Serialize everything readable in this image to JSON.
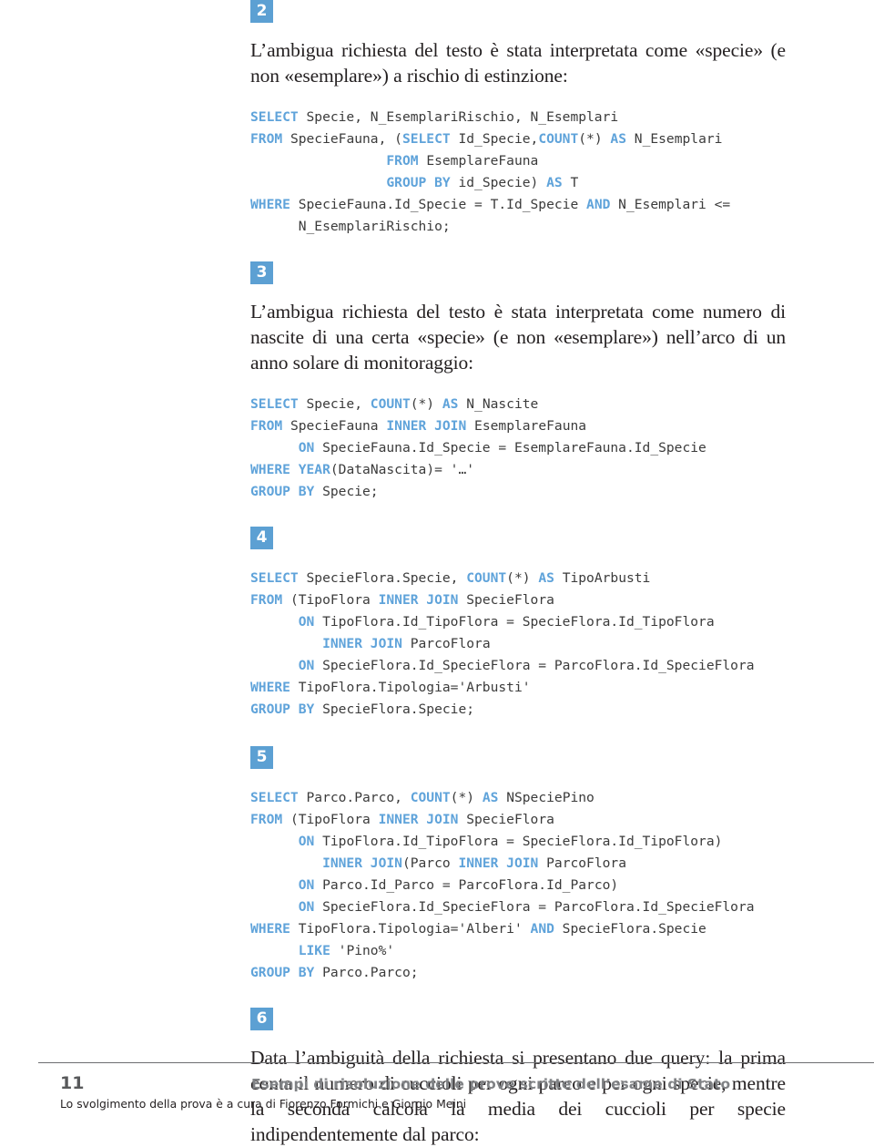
{
  "page": {
    "number": "11",
    "footer_title": "Esempi di risoluzione delle prove scritte dell’esame di Stato",
    "footer_note": "Lo svolgimento della prova è a cura di Fiorenzo Formichi e Giorgio Meini",
    "accent_color": "#5ca0d3",
    "keyword_color": "#5fa3da",
    "text_color": "#231f20",
    "footer_rule_color": "#6d6e71"
  },
  "sections": [
    {
      "badge": "2",
      "paragraph": "L’ambigua richiesta del testo è stata interpretata come «specie» (e non «esemplare») a rischio di estinzione:",
      "code_lines": [
        [
          {
            "t": "SELECT",
            "k": true
          },
          {
            "t": " Specie, N_EsemplariRischio, N_Esemplari",
            "k": false
          }
        ],
        [
          {
            "t": "FROM",
            "k": true
          },
          {
            "t": " SpecieFauna, (",
            "k": false
          },
          {
            "t": "SELECT",
            "k": true
          },
          {
            "t": " Id_Specie,",
            "k": false
          },
          {
            "t": "COUNT",
            "k": true
          },
          {
            "t": "(*) ",
            "k": false
          },
          {
            "t": "AS",
            "k": true
          },
          {
            "t": " N_Esemplari",
            "k": false
          }
        ],
        [
          {
            "t": "                 ",
            "k": false
          },
          {
            "t": "FROM",
            "k": true
          },
          {
            "t": " EsemplareFauna",
            "k": false
          }
        ],
        [
          {
            "t": "                 ",
            "k": false
          },
          {
            "t": "GROUP BY",
            "k": true
          },
          {
            "t": " id_Specie) ",
            "k": false
          },
          {
            "t": "AS",
            "k": true
          },
          {
            "t": " T",
            "k": false
          }
        ],
        [
          {
            "t": "WHERE",
            "k": true
          },
          {
            "t": " SpecieFauna.Id_Specie = T.Id_Specie ",
            "k": false
          },
          {
            "t": "AND",
            "k": true
          },
          {
            "t": " N_Esemplari <=",
            "k": false
          }
        ],
        [
          {
            "t": "      N_EsemplariRischio;",
            "k": false
          }
        ]
      ]
    },
    {
      "badge": "3",
      "paragraph": "L’ambigua richiesta del testo è stata interpretata come numero di nascite di una certa «specie» (e non «esemplare») nell’arco di un anno solare di monitoraggio:",
      "code_lines": [
        [
          {
            "t": "SELECT",
            "k": true
          },
          {
            "t": " Specie, ",
            "k": false
          },
          {
            "t": "COUNT",
            "k": true
          },
          {
            "t": "(*) ",
            "k": false
          },
          {
            "t": "AS",
            "k": true
          },
          {
            "t": " N_Nascite",
            "k": false
          }
        ],
        [
          {
            "t": "FROM",
            "k": true
          },
          {
            "t": " SpecieFauna ",
            "k": false
          },
          {
            "t": "INNER JOIN",
            "k": true
          },
          {
            "t": " EsemplareFauna",
            "k": false
          }
        ],
        [
          {
            "t": "      ",
            "k": false
          },
          {
            "t": "ON",
            "k": true
          },
          {
            "t": " SpecieFauna.Id_Specie = EsemplareFauna.Id_Specie",
            "k": false
          }
        ],
        [
          {
            "t": "WHERE",
            "k": true
          },
          {
            "t": " ",
            "k": false
          },
          {
            "t": "YEAR",
            "k": true
          },
          {
            "t": "(DataNascita)= '…'",
            "k": false
          }
        ],
        [
          {
            "t": "GROUP BY",
            "k": true
          },
          {
            "t": " Specie;",
            "k": false
          }
        ]
      ]
    },
    {
      "badge": "4",
      "paragraph": "",
      "code_lines": [
        [
          {
            "t": "SELECT",
            "k": true
          },
          {
            "t": " SpecieFlora.Specie, ",
            "k": false
          },
          {
            "t": "COUNT",
            "k": true
          },
          {
            "t": "(*) ",
            "k": false
          },
          {
            "t": "AS",
            "k": true
          },
          {
            "t": " TipoArbusti",
            "k": false
          }
        ],
        [
          {
            "t": "FROM",
            "k": true
          },
          {
            "t": " (TipoFlora ",
            "k": false
          },
          {
            "t": "INNER JOIN",
            "k": true
          },
          {
            "t": " SpecieFlora",
            "k": false
          }
        ],
        [
          {
            "t": "      ",
            "k": false
          },
          {
            "t": "ON",
            "k": true
          },
          {
            "t": " TipoFlora.Id_TipoFlora = SpecieFlora.Id_TipoFlora",
            "k": false
          }
        ],
        [
          {
            "t": "         ",
            "k": false
          },
          {
            "t": "INNER JOIN",
            "k": true
          },
          {
            "t": " ParcoFlora",
            "k": false
          }
        ],
        [
          {
            "t": "      ",
            "k": false
          },
          {
            "t": "ON",
            "k": true
          },
          {
            "t": " SpecieFlora.Id_SpecieFlora = ParcoFlora.Id_SpecieFlora",
            "k": false
          }
        ],
        [
          {
            "t": "WHERE",
            "k": true
          },
          {
            "t": " TipoFlora.Tipologia='Arbusti'",
            "k": false
          }
        ],
        [
          {
            "t": "GROUP BY",
            "k": true
          },
          {
            "t": " SpecieFlora.Specie;",
            "k": false
          }
        ]
      ]
    },
    {
      "badge": "5",
      "paragraph": "",
      "code_lines": [
        [
          {
            "t": "SELECT",
            "k": true
          },
          {
            "t": " Parco.Parco, ",
            "k": false
          },
          {
            "t": "COUNT",
            "k": true
          },
          {
            "t": "(*) ",
            "k": false
          },
          {
            "t": "AS",
            "k": true
          },
          {
            "t": " NSpeciePino",
            "k": false
          }
        ],
        [
          {
            "t": "FROM",
            "k": true
          },
          {
            "t": " (TipoFlora ",
            "k": false
          },
          {
            "t": "INNER JOIN",
            "k": true
          },
          {
            "t": " SpecieFlora",
            "k": false
          }
        ],
        [
          {
            "t": "      ",
            "k": false
          },
          {
            "t": "ON",
            "k": true
          },
          {
            "t": " TipoFlora.Id_TipoFlora = SpecieFlora.Id_TipoFlora)",
            "k": false
          }
        ],
        [
          {
            "t": "         ",
            "k": false
          },
          {
            "t": "INNER JOIN",
            "k": true
          },
          {
            "t": "(Parco ",
            "k": false
          },
          {
            "t": "INNER JOIN",
            "k": true
          },
          {
            "t": " ParcoFlora",
            "k": false
          }
        ],
        [
          {
            "t": "      ",
            "k": false
          },
          {
            "t": "ON",
            "k": true
          },
          {
            "t": " Parco.Id_Parco = ParcoFlora.Id_Parco)",
            "k": false
          }
        ],
        [
          {
            "t": "      ",
            "k": false
          },
          {
            "t": "ON",
            "k": true
          },
          {
            "t": " SpecieFlora.Id_SpecieFlora = ParcoFlora.Id_SpecieFlora",
            "k": false
          }
        ],
        [
          {
            "t": "WHERE",
            "k": true
          },
          {
            "t": " TipoFlora.Tipologia='Alberi' ",
            "k": false
          },
          {
            "t": "AND",
            "k": true
          },
          {
            "t": " SpecieFlora.Specie",
            "k": false
          }
        ],
        [
          {
            "t": "      ",
            "k": false
          },
          {
            "t": "LIKE",
            "k": true
          },
          {
            "t": " 'Pino%'",
            "k": false
          }
        ],
        [
          {
            "t": "GROUP BY",
            "k": true
          },
          {
            "t": " Parco.Parco;",
            "k": false
          }
        ]
      ]
    },
    {
      "badge": "6",
      "paragraph": "Data l’ambiguità della richiesta si presentano due query: la prima conta il numero di cuccioli per ogni parco e per ogni specie, mentre la seconda calcola la media dei cuccioli per specie indipendentemente dal parco:",
      "code_lines": []
    }
  ]
}
